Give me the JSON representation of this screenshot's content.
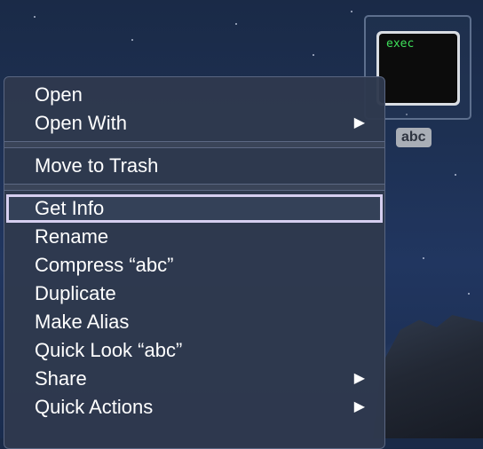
{
  "desktop": {
    "file_icon": {
      "name": "abc",
      "preview_text": "exec"
    }
  },
  "context_menu": {
    "groups": [
      [
        {
          "label": "Open",
          "submenu": false
        },
        {
          "label": "Open With",
          "submenu": true
        }
      ],
      [
        {
          "label": "Move to Trash",
          "submenu": false
        }
      ],
      [
        {
          "label": "Get Info",
          "submenu": false,
          "highlighted": true
        },
        {
          "label": "Rename",
          "submenu": false
        },
        {
          "label": "Compress “abc”",
          "submenu": false
        },
        {
          "label": "Duplicate",
          "submenu": false
        },
        {
          "label": "Make Alias",
          "submenu": false
        },
        {
          "label": "Quick Look “abc”",
          "submenu": false
        },
        {
          "label": "Share",
          "submenu": true
        },
        {
          "label": "Quick Actions",
          "submenu": true
        }
      ]
    ],
    "submenu_arrow_glyph": "▶",
    "highlight_color": "#d6cff0"
  }
}
